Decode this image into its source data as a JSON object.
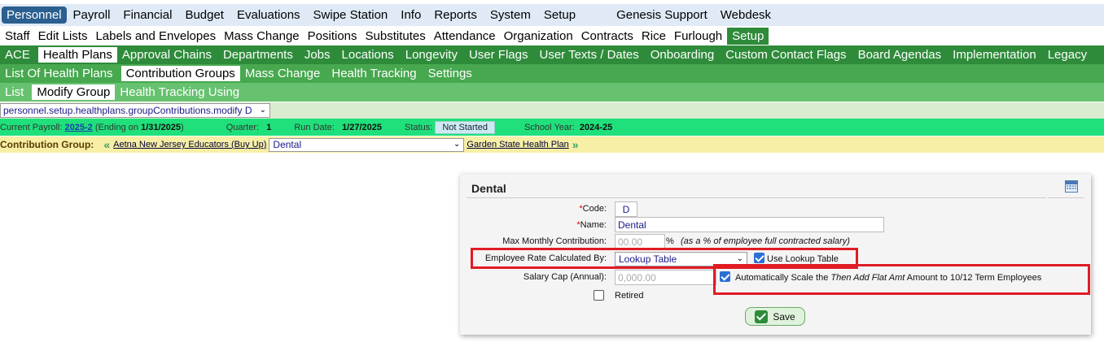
{
  "nav1": {
    "items": [
      "Personnel",
      "Payroll",
      "Financial",
      "Budget",
      "Evaluations",
      "Swipe Station",
      "Info",
      "Reports",
      "System",
      "Setup",
      "Genesis Support",
      "Webdesk"
    ],
    "active": "Personnel"
  },
  "nav2": {
    "items": [
      "Staff",
      "Edit Lists",
      "Labels and Envelopes",
      "Mass Change",
      "Positions",
      "Substitutes",
      "Attendance",
      "Organization",
      "Contracts",
      "Rice",
      "Furlough",
      "Setup"
    ],
    "active": "Setup"
  },
  "nav3": {
    "items": [
      "ACE",
      "Health Plans",
      "Approval Chains",
      "Departments",
      "Jobs",
      "Locations",
      "Longevity",
      "User Flags",
      "User Texts / Dates",
      "Onboarding",
      "Custom Contact Flags",
      "Board Agendas",
      "Implementation",
      "Legacy"
    ],
    "active": "Health Plans"
  },
  "nav4": {
    "items": [
      "List Of Health Plans",
      "Contribution Groups",
      "Mass Change",
      "Health Tracking",
      "Settings"
    ],
    "active": "Contribution Groups"
  },
  "nav5": {
    "items": [
      "List",
      "Modify Group",
      "Health Tracking Using"
    ],
    "active": "Modify Group"
  },
  "path_select": {
    "value": "personnel.setup.healthplans.groupContributions.modify D"
  },
  "status": {
    "payroll_label": "Current Payroll:",
    "payroll_value": "2025-2",
    "ending_prefix": "(Ending on",
    "ending_date": "1/31/2025",
    "ending_suffix": ")",
    "quarter_label": "Quarter:",
    "quarter_value": "1",
    "run_date_label": "Run Date:",
    "run_date_value": "1/27/2025",
    "status_label": "Status:",
    "status_value": "Not Started",
    "school_year_label": "School Year:",
    "school_year_value": "2024-25"
  },
  "contribution_group": {
    "label": "Contribution Group:",
    "prev_link": "Aetna New Jersey Educators (Buy Up)",
    "selected": "Dental",
    "next_link": "Garden State Health Plan"
  },
  "panel": {
    "title": "Dental",
    "code_label": "Code:",
    "code_value": "D",
    "name_label": "Name:",
    "name_value": "Dental",
    "max_label": "Max Monthly Contribution:",
    "max_value": "00.00",
    "max_unit": "%",
    "max_note": "(as a % of employee full contracted salary)",
    "rate_label": "Employee Rate Calculated By:",
    "rate_value": "Lookup Table",
    "use_lookup_label": "Use Lookup Table",
    "use_lookup_checked": true,
    "salary_cap_label": "Salary Cap (Annual):",
    "salary_cap_placeholder": "0,000.00",
    "auto_scale_prefix": "Automatically Scale the",
    "auto_scale_italic": "Then Add Flat Amt",
    "auto_scale_suffix": "Amount to 10/12 Term Employees",
    "auto_scale_checked": true,
    "retired_label": "Retired",
    "retired_checked": false,
    "save_label": "Save"
  },
  "colors": {
    "highlight_red": "#e01b24",
    "nav_green": "#2e8b3a",
    "status_green": "#1fe07a"
  }
}
